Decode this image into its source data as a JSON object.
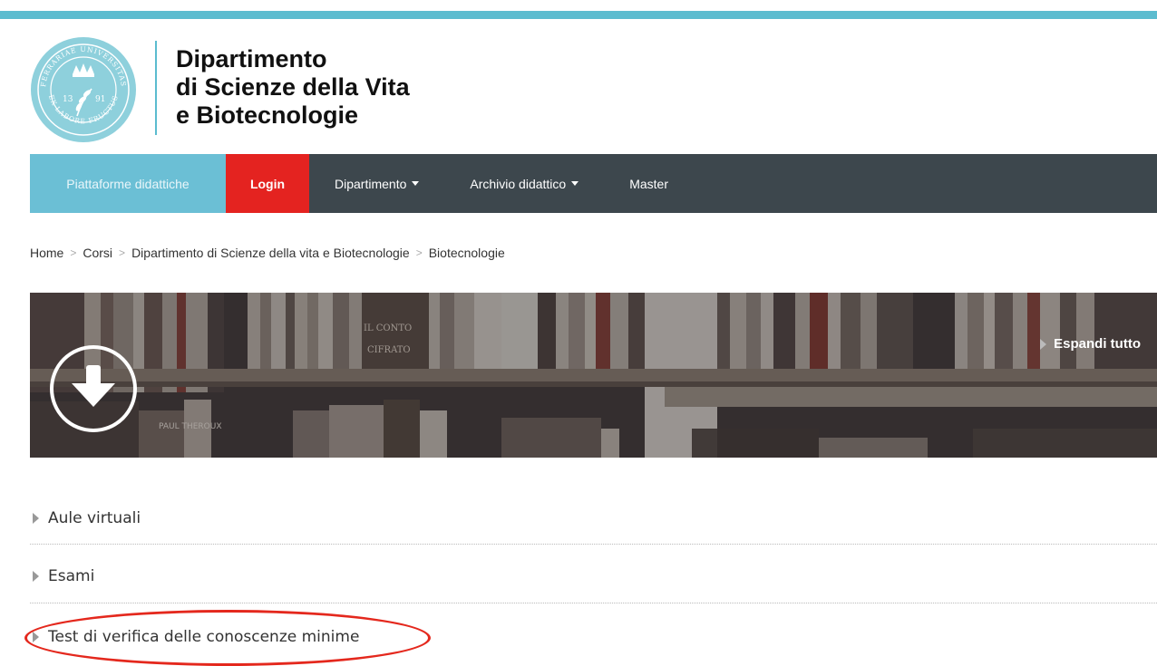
{
  "header": {
    "title_lines": [
      "Dipartimento",
      "di Scienze della Vita",
      "e Biotecnologie"
    ],
    "logo": {
      "ring_top_text": "FERRARIAE UNIVERSITAS",
      "ring_bottom_text": "EX LABORE FRUCTUS",
      "year_left": "13",
      "year_right": "91"
    }
  },
  "nav": {
    "piattaforme": "Piattaforme didattiche",
    "login": "Login",
    "dipartimento": "Dipartimento",
    "archivio": "Archivio didattico",
    "master": "Master"
  },
  "breadcrumb": [
    "Home",
    "Corsi",
    "Dipartimento di Scienze della vita e Biotecnologie",
    "Biotecnologie"
  ],
  "banner": {
    "expand_label": "Espandi tutto",
    "book_texts": [
      "IL CONTO",
      "CIFRATO",
      "PAUL THEROUX"
    ]
  },
  "sections": [
    "Aule virtuali",
    "Esami",
    "Test di verifica delle conoscenze minime"
  ],
  "colors": {
    "accent": "#5bbccf",
    "navbar": "#3d474d",
    "login": "#e42320",
    "highlight": "#e4281d"
  }
}
